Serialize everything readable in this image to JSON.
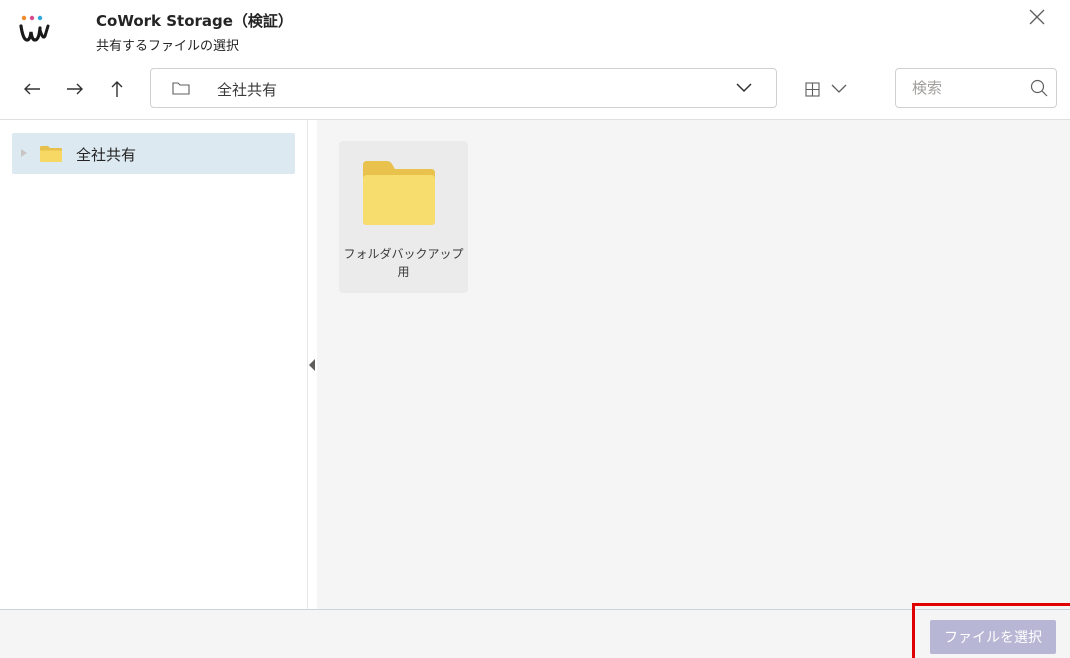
{
  "header": {
    "title": "CoWork Storage（検証）",
    "subtitle": "共有するファイルの選択",
    "close_icon": "close-icon"
  },
  "toolbar": {
    "back_icon": "arrow-left-icon",
    "forward_icon": "arrow-right-icon",
    "up_icon": "arrow-up-icon",
    "path": "全社共有",
    "view_icon": "grid-view-icon",
    "search_placeholder": "検索"
  },
  "sidebar": {
    "items": [
      {
        "label": "全社共有"
      }
    ]
  },
  "content": {
    "items": [
      {
        "label": "フォルダバックアップ用"
      }
    ]
  },
  "footer": {
    "select_label": "ファイルを選択"
  },
  "colors": {
    "folder": "#f2d66a",
    "folder_dark": "#e7c04c",
    "selected_tree": "#dde9f1",
    "primary_disabled": "#b7b6d4",
    "highlight": "#e00000"
  }
}
